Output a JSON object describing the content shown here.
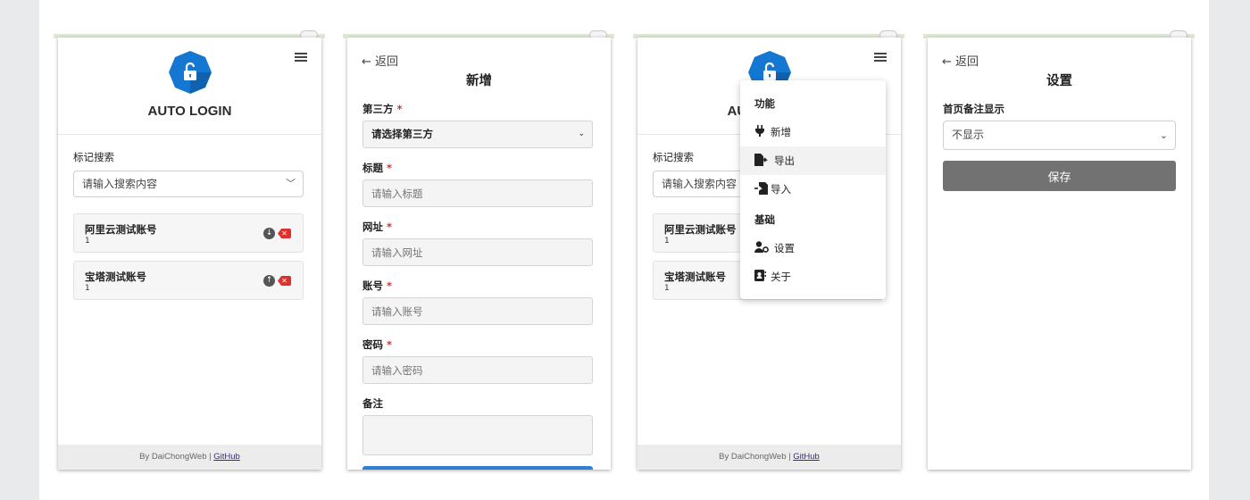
{
  "app": {
    "title": "AUTO LOGIN",
    "footer_by": "By DaiChongWeb | ",
    "footer_link": "GitHub"
  },
  "colors": {
    "logo_blue": "#1478d3",
    "delete_red": "#e0302d",
    "required": "#d9302a",
    "save_button": "#727272"
  },
  "home": {
    "search_label": "标记搜索",
    "search_placeholder": "请输入搜索内容",
    "items": [
      {
        "title": "阿里云测试账号",
        "sub": "1",
        "move_icon": "arrow-down-circle-icon"
      },
      {
        "title": "宝塔测试账号",
        "sub": "1",
        "move_icon": "arrow-up-circle-icon"
      }
    ]
  },
  "add": {
    "back": "← 返回",
    "heading": "新增",
    "third_party_label": "第三方",
    "third_party_value": "请选择第三方",
    "title_label": "标题",
    "title_placeholder": "请输入标题",
    "url_label": "网址",
    "url_placeholder": "请输入网址",
    "account_label": "账号",
    "account_placeholder": "请输入账号",
    "password_label": "密码",
    "password_placeholder": "请输入密码",
    "note_label": "备注",
    "required_mark": "*"
  },
  "menu": {
    "section_functions": "功能",
    "new": "新增",
    "export": "导出",
    "import": "导入",
    "section_basic": "基础",
    "settings": "设置",
    "about": "关于",
    "search_placeholder_truncated": "请输入搜索内容"
  },
  "settings": {
    "back": "← 返回",
    "heading": "设置",
    "note_display_label": "首页备注显示",
    "note_display_value": "不显示",
    "save": "保存"
  }
}
